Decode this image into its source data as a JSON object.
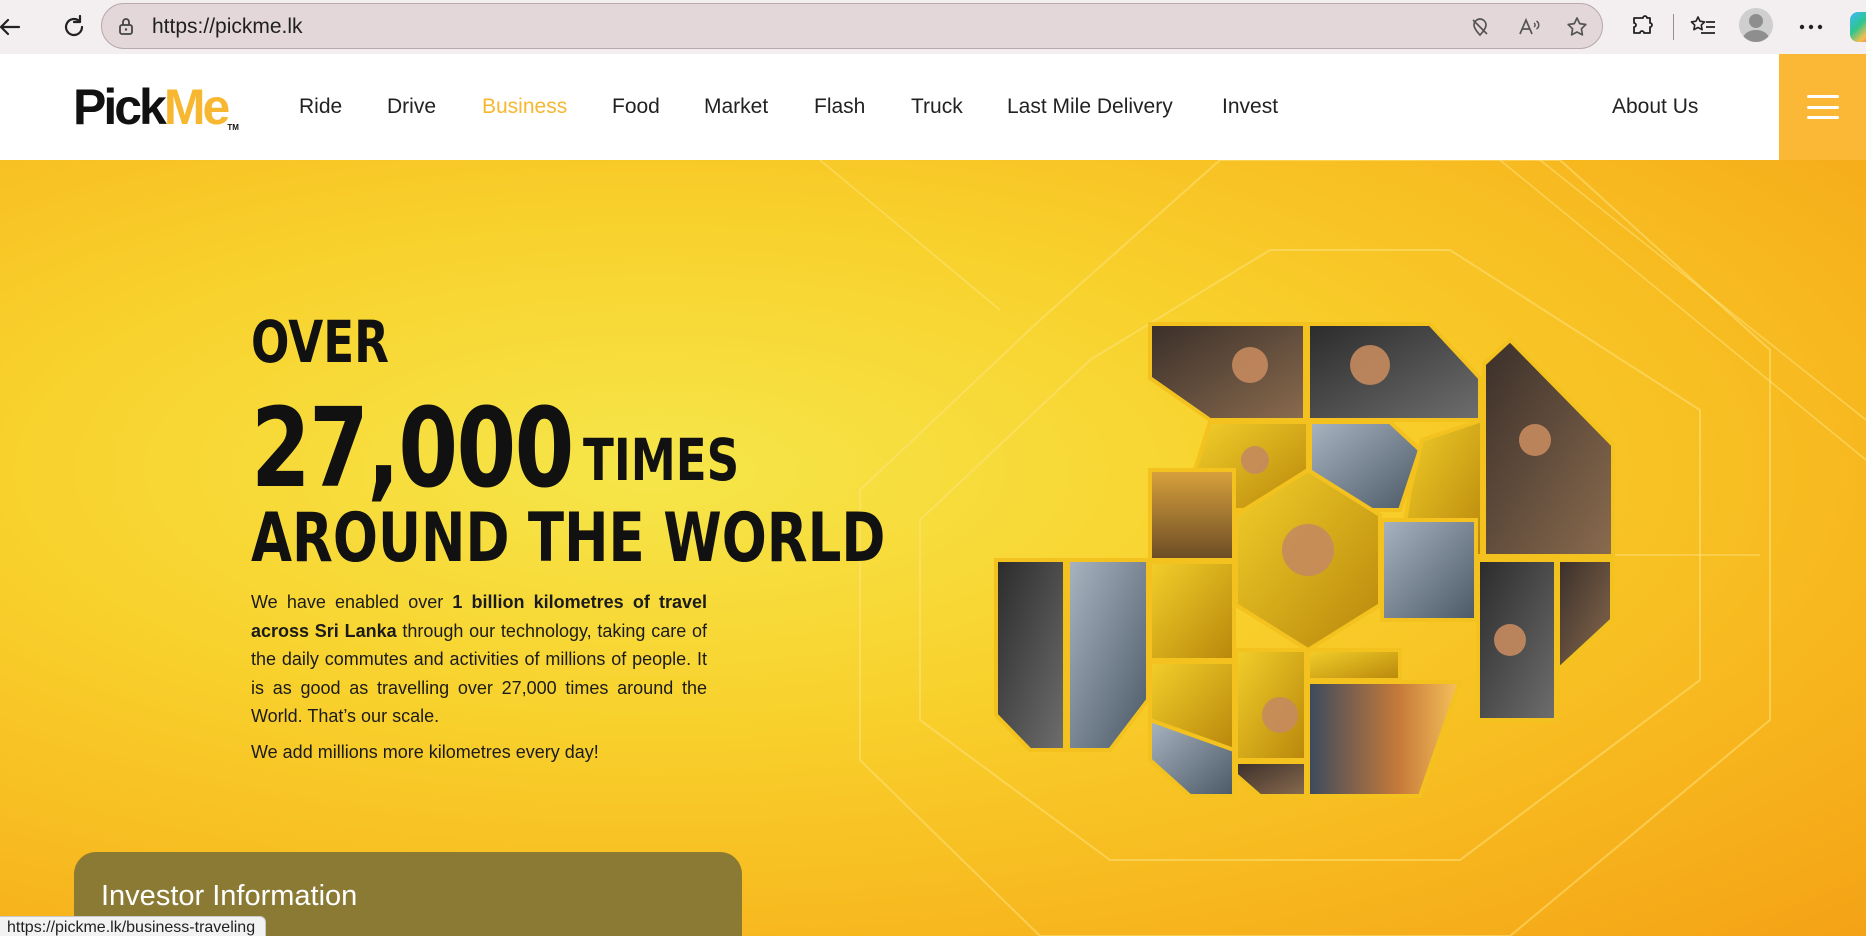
{
  "browser": {
    "url": "https://pickme.lk",
    "status_url": "https://pickme.lk/business-traveling"
  },
  "header": {
    "logo_pick": "Pick",
    "logo_me": "Me",
    "logo_tm": "TM",
    "nav": [
      "Ride",
      "Drive",
      "Business",
      "Food",
      "Market",
      "Flash",
      "Truck",
      "Last Mile Delivery",
      "Invest"
    ],
    "active_nav": "Business",
    "about": "About Us"
  },
  "hero": {
    "over": "OVER",
    "number": "27,000",
    "times": "TIMES",
    "around": "AROUND THE WORLD",
    "para_pre": "We have enabled over ",
    "para_bold1": "1 billion kilometres of travel across Sri Lanka",
    "para_post": " through our technology, taking care of the daily commutes and activities of millions of people. It is as good as travelling over 27,000 times around the World. That’s our scale.",
    "para2": "We add millions more kilometres every day!"
  },
  "investor": {
    "title": "Investor Information"
  },
  "colors": {
    "brand_yellow": "#f7b731",
    "menu_bg": "#fbb836",
    "investor_bg": "#8b7a34"
  },
  "icons": [
    "back-arrow-icon",
    "reload-icon",
    "lock-icon",
    "tracking-prevention-icon",
    "read-aloud-icon",
    "favorite-star-icon",
    "extensions-icon",
    "favorites-list-icon",
    "profile-avatar",
    "more-icon",
    "copilot-icon",
    "hamburger-menu-icon"
  ]
}
